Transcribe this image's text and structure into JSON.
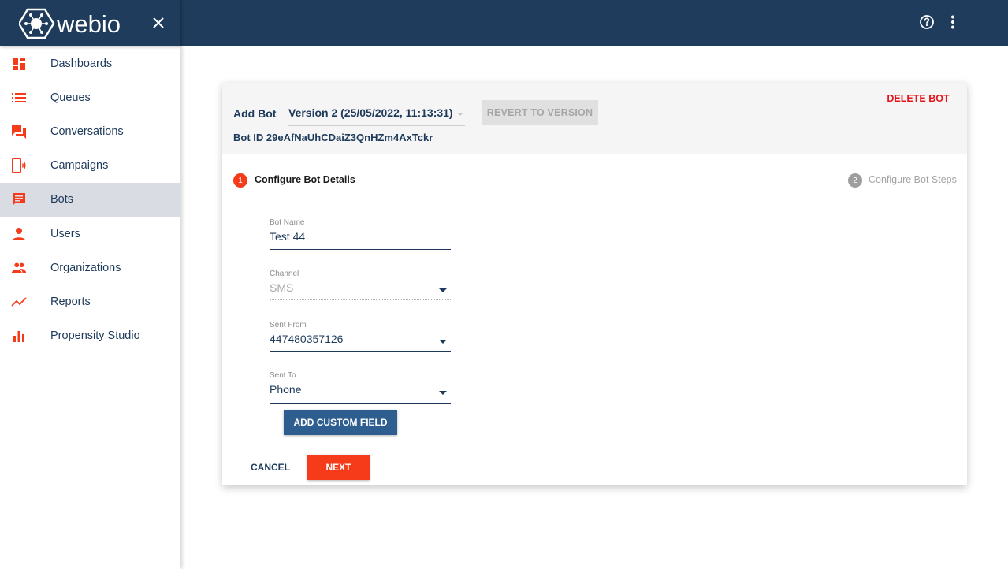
{
  "app": {
    "logo_text": "webio",
    "brand_color": "#1f3c5c",
    "accent_color": "#f53b1a"
  },
  "header": {
    "close_icon": "close-icon",
    "help_icon": "help-circle-icon",
    "more_icon": "more-vertical-icon"
  },
  "sidebar": {
    "items": [
      {
        "label": "Dashboards",
        "icon": "dashboard-icon"
      },
      {
        "label": "Queues",
        "icon": "list-icon"
      },
      {
        "label": "Conversations",
        "icon": "forum-icon"
      },
      {
        "label": "Campaigns",
        "icon": "phone-broadcast-icon"
      },
      {
        "label": "Bots",
        "icon": "chat-bubble-icon",
        "active": true
      },
      {
        "label": "Users",
        "icon": "person-icon"
      },
      {
        "label": "Organizations",
        "icon": "group-icon"
      },
      {
        "label": "Reports",
        "icon": "trending-up-icon"
      },
      {
        "label": "Propensity Studio",
        "icon": "bar-chart-icon"
      }
    ]
  },
  "card": {
    "add_bot": "Add Bot",
    "version_selected": "Version 2 (25/05/2022, 11:13:31)",
    "revert_label": "REVERT TO VERSION",
    "delete_label": "DELETE BOT",
    "bot_id": "Bot ID 29eAfNaUhCDaiZ3QnHZm4AxTckr"
  },
  "stepper": {
    "step1_number": "1",
    "step1_label": "Configure Bot Details",
    "step2_number": "2",
    "step2_label": "Configure Bot Steps"
  },
  "form": {
    "bot_name_label": "Bot Name",
    "bot_name_value": "Test 44",
    "channel_label": "Channel",
    "channel_value": "SMS",
    "sent_from_label": "Sent From",
    "sent_from_value": "447480357126",
    "sent_to_label": "Sent To",
    "sent_to_value": "Phone",
    "add_custom_field_label": "ADD CUSTOM FIELD",
    "cancel_label": "CANCEL",
    "next_label": "NEXT"
  }
}
